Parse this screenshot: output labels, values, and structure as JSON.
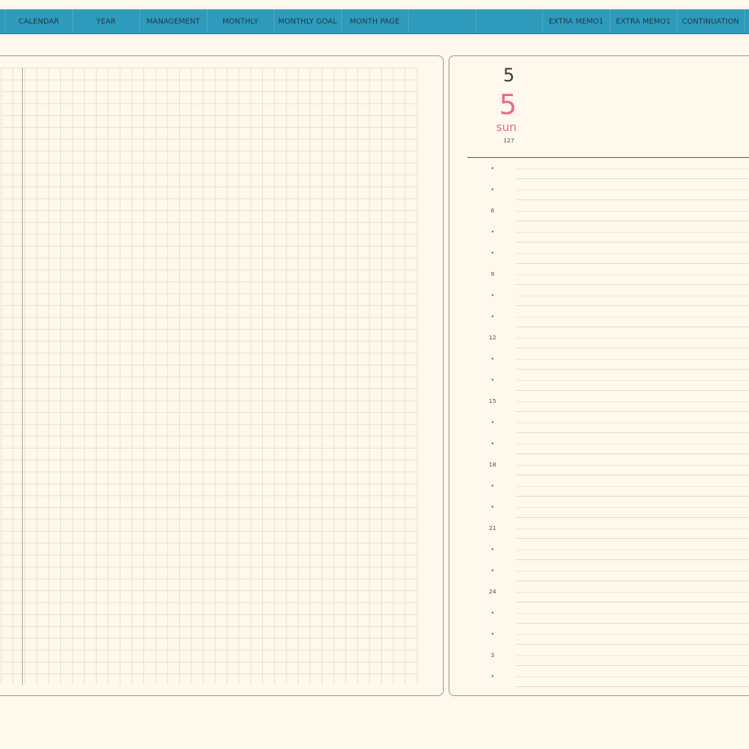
{
  "tabs": [
    {
      "id": "edge",
      "label": ""
    },
    {
      "id": "calendar",
      "label": "CALENDAR"
    },
    {
      "id": "year",
      "label": "YEAR"
    },
    {
      "id": "management",
      "label": "MANAGEMENT"
    },
    {
      "id": "monthly",
      "label": "MONTHLY"
    },
    {
      "id": "monthly-goal",
      "label": "MONTHLY GOAL"
    },
    {
      "id": "month-page",
      "label": "MONTH PAGE"
    },
    {
      "id": "blank-1",
      "label": ""
    },
    {
      "id": "blank-2",
      "label": ""
    },
    {
      "id": "extra-memo-1",
      "label": "EXTRA MEMO1"
    },
    {
      "id": "extra-memo-2",
      "label": "EXTRA MEMO1"
    },
    {
      "id": "continuation",
      "label": "CONTINUATION"
    }
  ],
  "date": {
    "month": "5",
    "day": "5",
    "weekday": "sun",
    "day_of_year": "127"
  },
  "timeline": [
    "•",
    "•",
    "6",
    "•",
    "•",
    "9",
    "•",
    "•",
    "12",
    "•",
    "•",
    "15",
    "•",
    "•",
    "18",
    "•",
    "•",
    "21",
    "•",
    "•",
    "24",
    "•",
    "•",
    "3",
    "•"
  ],
  "colors": {
    "tab_bar": "#2f9bbc",
    "background": "#fff8ec",
    "accent_date": "#e86a8c",
    "grid_line": "#ece2d2"
  }
}
